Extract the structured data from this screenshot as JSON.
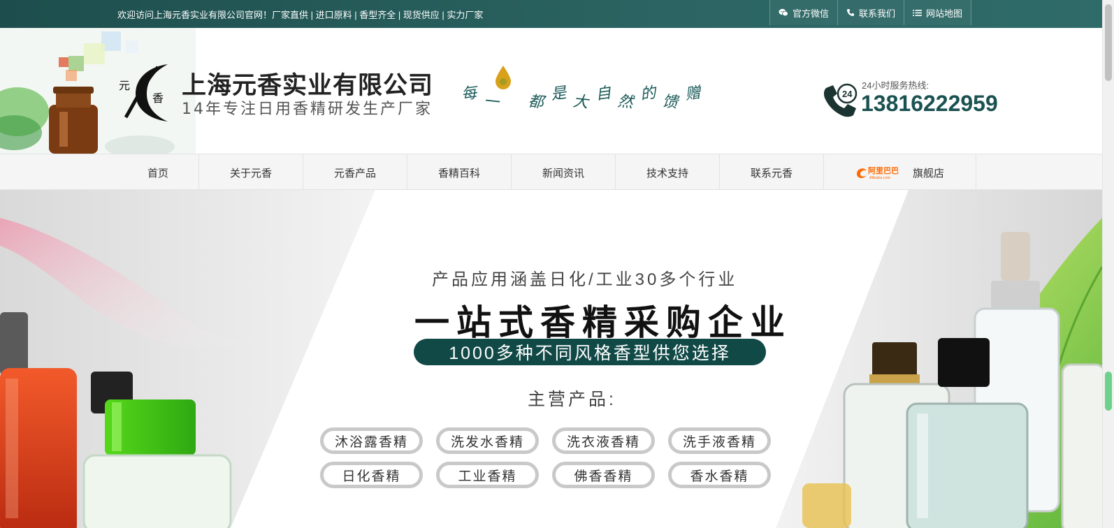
{
  "topbar": {
    "welcome": "欢迎访问上海元香实业有限公司官网！厂家直供 | 进口原料 | 香型齐全 | 现货供应 | 实力厂家",
    "links": [
      {
        "label": "官方微信",
        "icon": "wechat-icon"
      },
      {
        "label": "联系我们",
        "icon": "phone-icon"
      },
      {
        "label": "网站地图",
        "icon": "list-icon"
      }
    ]
  },
  "header": {
    "company_name": "上海元香实业有限公司",
    "company_sub": "14年专注日用香精研发生产厂家",
    "slogan": [
      "每",
      "一",
      "滴",
      "都",
      "是",
      "大",
      "自",
      "然",
      "的",
      "馈",
      "赠"
    ],
    "hotline_label": "24小时服务热线:",
    "hotline_number": "13816222959",
    "phone_badge": "24"
  },
  "nav": {
    "items": [
      "首页",
      "关于元香",
      "元香产品",
      "香精百科",
      "新闻资讯",
      "技术支持",
      "联系元香"
    ],
    "alibaba_label": "阿里巴巴",
    "alibaba_sub": "Alibaba.com",
    "flagship_label": "旗舰店"
  },
  "banner": {
    "subtitle": "产品应用涵盖日化/工业30多个行业",
    "headline": "一站式香精采购企业",
    "pill": "1000多种不同风格香型供您选择",
    "main_label": "主营产品:",
    "tags": [
      "沐浴露香精",
      "洗发水香精",
      "洗衣液香精",
      "洗手液香精",
      "日化香精",
      "工业香精",
      "佛香香精",
      "香水香精"
    ]
  },
  "colors": {
    "brand": "#1b5251",
    "topbar": "#2b6462",
    "pill": "#114947",
    "alibaba": "#ff6a00"
  }
}
